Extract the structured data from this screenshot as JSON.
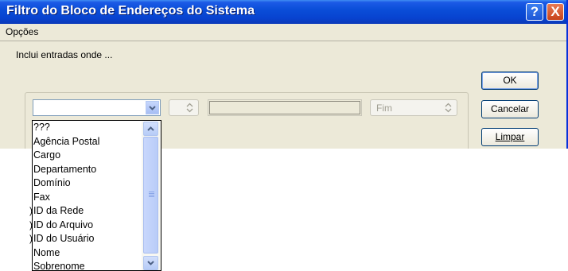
{
  "window": {
    "title": "Filtro do Bloco de Endereços do Sistema",
    "help_label": "?",
    "close_label": "X"
  },
  "menu": {
    "items": [
      "Opções"
    ]
  },
  "filter": {
    "section_label": "Inclui entradas onde ...",
    "field_value": "",
    "text_value": "",
    "end_select": "Fim"
  },
  "buttons": {
    "ok": "OK",
    "cancel": "Cancelar",
    "clear": "Limpar"
  },
  "dropdown": {
    "options": [
      "???",
      "Agência Postal",
      "Cargo",
      "Departamento",
      "Domínio",
      "Fax",
      "ID da Rede",
      "ID do Arquivo",
      "ID do Usuário",
      "Nome",
      "Sobrenome"
    ]
  },
  "icons": {
    "combo_arrow": "chevron-down-icon",
    "spin": "up-down-icon",
    "scroll_up": "chevron-up-icon",
    "scroll_down": "chevron-down-icon"
  },
  "colors": {
    "title_bar": "#0a4ed8",
    "window_bg": "#ece9d8",
    "close_button": "#c8431b"
  }
}
